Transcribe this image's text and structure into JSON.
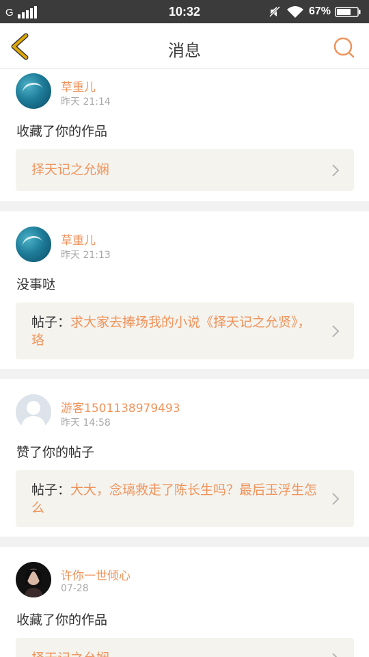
{
  "status_bar": {
    "carrier": "G",
    "time": "10:32",
    "battery": "67%"
  },
  "header": {
    "title": "消息"
  },
  "colors": {
    "accent": "#f0935b",
    "back_icon": "#e0a800",
    "ref_bg": "#f4f3ee"
  },
  "messages": [
    {
      "username": "草重儿",
      "time": "昨天 21:14",
      "action": "收藏了你的作品",
      "ref_prefix": "",
      "ref_text": "择天记之允娴",
      "avatar": "teal-artwork-avatar"
    },
    {
      "username": "草重儿",
      "time": "昨天 21:13",
      "action": "没事哒",
      "ref_prefix": "帖子：",
      "ref_text": "求大家去捧场我的小说《择天记之允贤》，珞",
      "avatar": "teal-artwork-avatar"
    },
    {
      "username": "游客1501138979493",
      "time": "昨天 14:58",
      "action": "赞了你的帖子",
      "ref_prefix": "帖子：",
      "ref_text": "大大，念璃救走了陈长生吗？最后玉浮生怎么",
      "avatar": "default-person-avatar"
    },
    {
      "username": "许你一世倾心",
      "time": "07-28",
      "action": "收藏了你的作品",
      "ref_prefix": "",
      "ref_text": "择天记之允娴",
      "avatar": "portrait-avatar"
    }
  ]
}
